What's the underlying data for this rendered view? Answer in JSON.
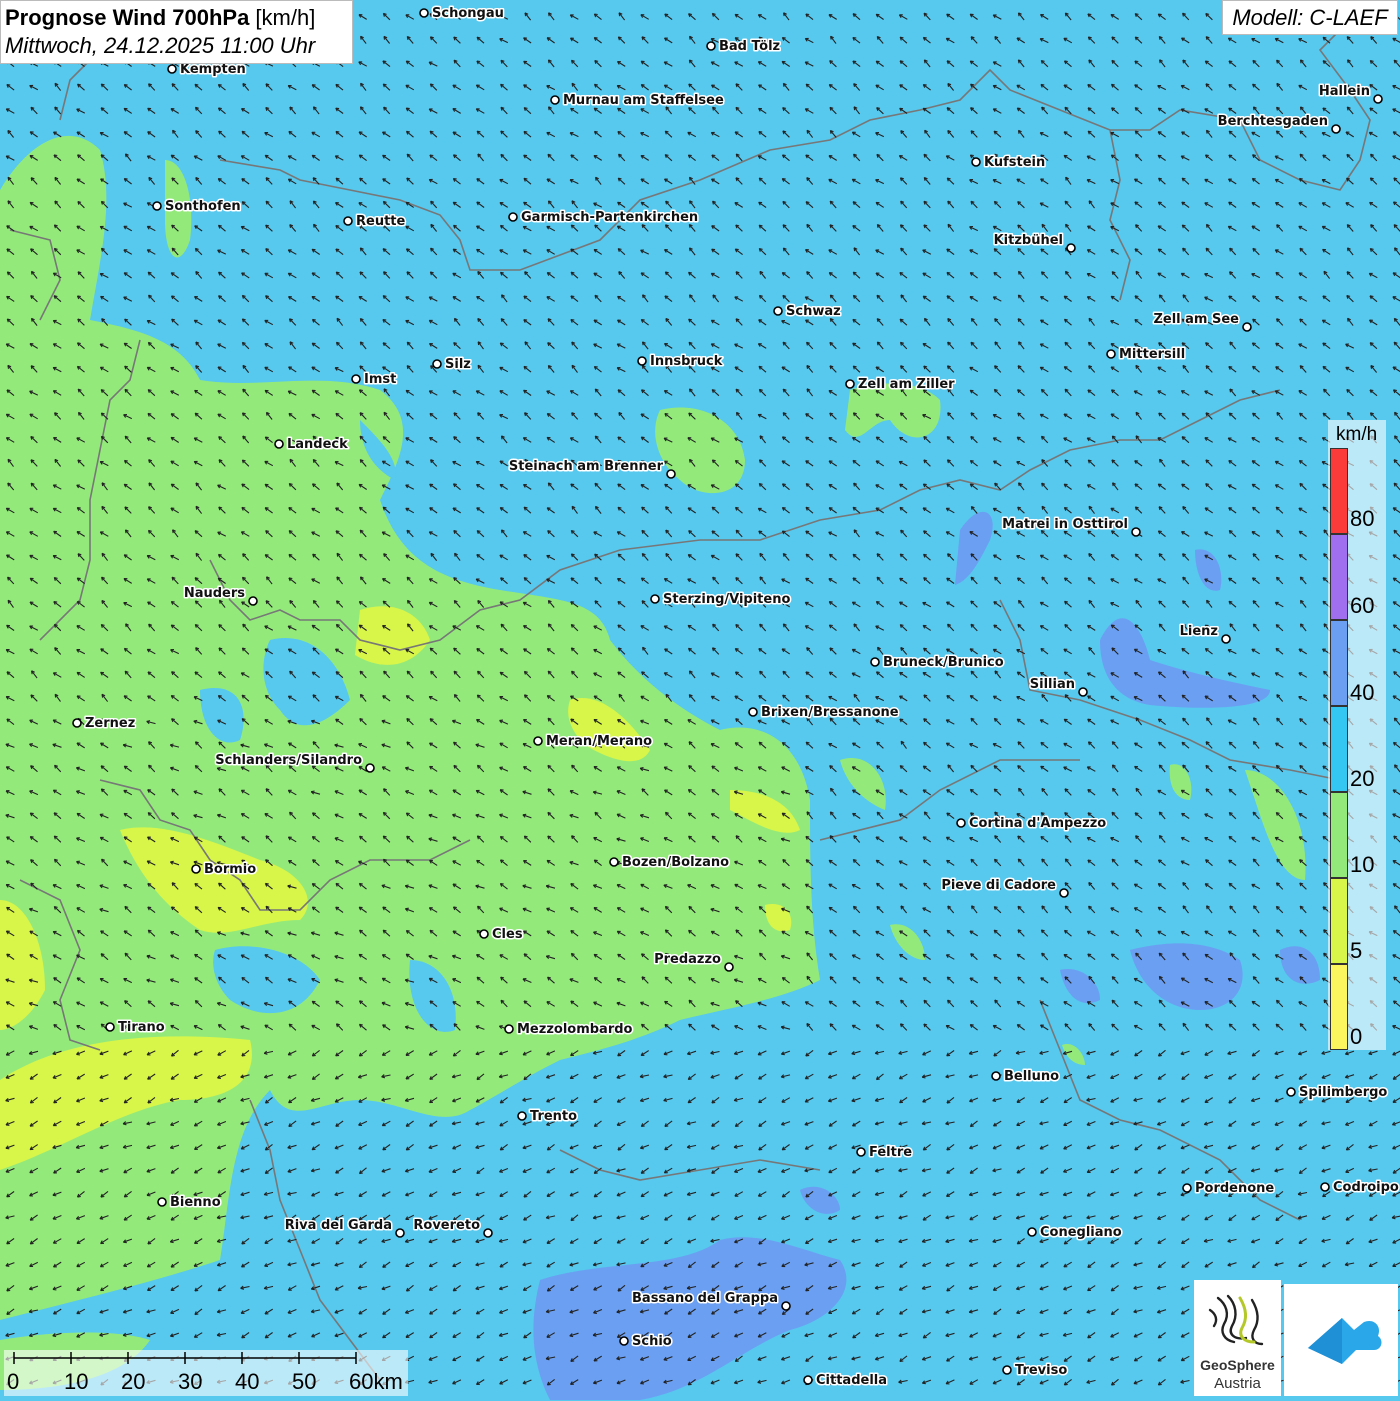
{
  "title": {
    "main": "Prognose Wind 700hPa",
    "unit": " [km/h]",
    "datetime": "Mittwoch, 24.12.2025 11:00 Uhr"
  },
  "model": "Modell: C-LAEF",
  "legend": {
    "unit": "km/h",
    "labels": [
      "80",
      "60",
      "40",
      "20",
      "10",
      "5",
      "0"
    ],
    "colors": [
      "#fb3a3a",
      "#9f6ff0",
      "#6b9ff2",
      "#33c7f2",
      "#93ea7a",
      "#d8f54a",
      "#fbf55e"
    ]
  },
  "scale_bar": {
    "labels": [
      "0",
      "10",
      "20",
      "30",
      "40",
      "50",
      "60km"
    ]
  },
  "logos": {
    "geosphere_line1": "GeoSphere",
    "geosphere_line2": "Austria"
  },
  "cities": [
    "Schongau",
    "Bad Tölz",
    "Kempten",
    "Murnau am Staffelsee",
    "Hallein",
    "Berchtesgaden",
    "Kufstein",
    "Sonthofen",
    "Reutte",
    "Garmisch-Partenkirchen",
    "Kitzbühel",
    "Schwaz",
    "Zell am See",
    "Mittersill",
    "Imst",
    "Silz",
    "Innsbruck",
    "Zell am Ziller",
    "Landeck",
    "Steinach am Brenner",
    "Matrei in Osttirol",
    "Nauders",
    "Sterzing/Vipiteno",
    "Lienz",
    "Bruneck/Brunico",
    "Sillian",
    "Zernez",
    "Brixen/Bressanone",
    "Meran/Merano",
    "Schlanders/Silandro",
    "Cortina d'Ampezzo",
    "Bozen/Bolzano",
    "Bormio",
    "Pieve di Cadore",
    "Cles",
    "Predazzo",
    "Tirano",
    "Mezzolombardo",
    "Belluno",
    "Spilimbergo",
    "Trento",
    "Feltre",
    "Pordenone",
    "Codroipo",
    "Bienno",
    "Riva del Garda",
    "Rovereto",
    "Conegliano",
    "Bassano del Grappa",
    "Schio",
    "Treviso",
    "Cittadella"
  ]
}
